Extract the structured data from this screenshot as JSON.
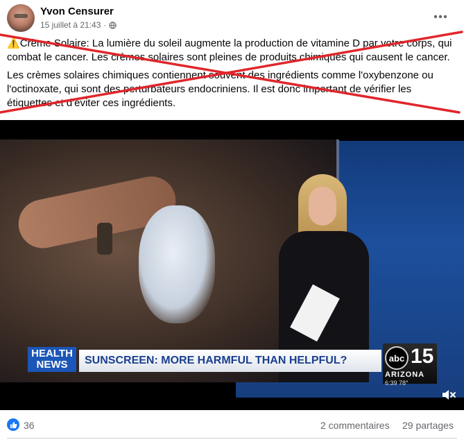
{
  "post": {
    "author": "Yvon Censurer",
    "timestamp": "15 juillet à 21:43",
    "separator": "·",
    "audience_icon": "globe-icon",
    "more_icon": "more-dots-icon",
    "warning_icon": "warning-icon",
    "paragraph1": "Crème Solaire: La lumière du soleil augmente la production de vitamine D par votre corps, qui combat le cancer. Les crèmes solaires sont pleines de produits chimiques qui causent le cancer.",
    "paragraph2": "Les crèmes solaires chimiques contiennent souvent des ingrédients comme l'oxybenzone ou l'octinoxate, qui sont des perturbateurs endocriniens. Il est donc important de vérifier les étiquettes et d'éviter ces ingrédients.",
    "overlay_mark_color": "#e0262b"
  },
  "video": {
    "badge_line1": "HEALTH",
    "badge_line2": "NEWS",
    "headline": "SUNSCREEN: MORE HARMFUL THAN HELPFUL?",
    "station_logo": "abc",
    "station_number": "15",
    "station_city": "ARIZONA",
    "station_small": "6:39  78°",
    "mute_icon": "mute-icon"
  },
  "footer": {
    "like_icon": "thumbs-up-icon",
    "like_count": "36",
    "comments": "2 commentaires",
    "shares": "29 partages"
  }
}
